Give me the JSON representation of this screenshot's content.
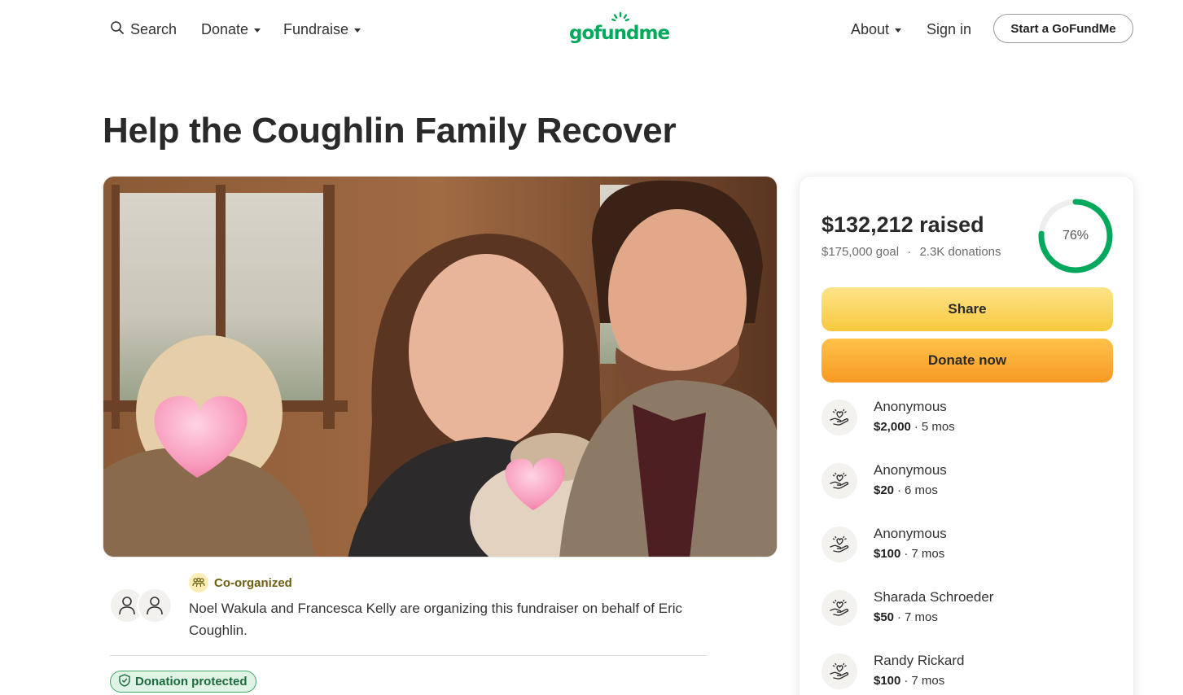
{
  "header": {
    "search_label": "Search",
    "donate_label": "Donate",
    "fundraise_label": "Fundraise",
    "logo_text": "gofundme",
    "about_label": "About",
    "signin_label": "Sign in",
    "start_label": "Start a GoFundMe"
  },
  "campaign": {
    "title": "Help the Coughlin Family Recover"
  },
  "organizer": {
    "badge": "Co-organized",
    "text": "Noel Wakula and Francesca Kelly are organizing this fundraiser on behalf of Eric Coughlin."
  },
  "protection": {
    "label": "Donation protected"
  },
  "stats": {
    "raised": "$132,212 raised",
    "goal": "$175,000 goal",
    "separator": "·",
    "donations": "2.3K donations",
    "progress_label": "76%",
    "progress_fraction": 0.76
  },
  "actions": {
    "share_label": "Share",
    "donate_label": "Donate now"
  },
  "donors": [
    {
      "name": "Anonymous",
      "amount": "$2,000",
      "time": "5 mos"
    },
    {
      "name": "Anonymous",
      "amount": "$20",
      "time": "6 mos"
    },
    {
      "name": "Anonymous",
      "amount": "$100",
      "time": "7 mos"
    },
    {
      "name": "Sharada Schroeder",
      "amount": "$50",
      "time": "7 mos"
    },
    {
      "name": "Randy Rickard",
      "amount": "$100",
      "time": "7 mos"
    }
  ],
  "colors": {
    "brand_green": "#02a95c",
    "share_yellow": "#f8c93d",
    "donate_orange": "#f79a24",
    "ring_track": "#eeeeee"
  },
  "icons": {
    "search": "search-icon",
    "caret": "chevron-down-icon",
    "logo_sun": "sun-rays-icon",
    "organizer_avatar": "person-icon",
    "coorganized": "people-group-icon",
    "protection": "shield-check-icon",
    "donor": "heart-hand-icon"
  }
}
